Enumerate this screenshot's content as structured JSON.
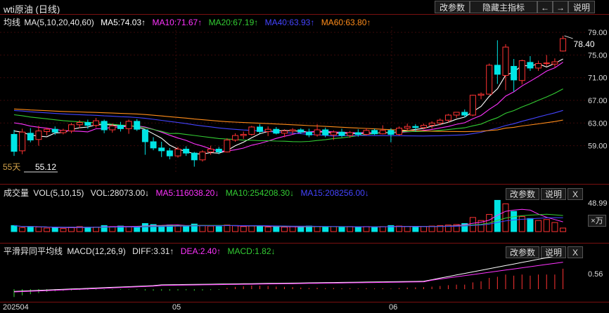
{
  "title": "wti原油 (日线)",
  "toolbar": {
    "modify_params": "改参数",
    "hide_indicator": "隐藏主指标",
    "prev_arrow": "←",
    "next_arrow": "→",
    "explain": "说明"
  },
  "main_panel": {
    "info": {
      "label": "均线",
      "ma_def": "MA(5,10,20,40,60)",
      "ma5": "MA5:74.03↑",
      "ma10": "MA10:71.67↑",
      "ma20": "MA20:67.19↑",
      "ma40": "MA40:63.93↑",
      "ma60": "MA60:63.80↑"
    },
    "colors": {
      "ma5": "#ffffff",
      "ma10": "#ff33ff",
      "ma20": "#33cc33",
      "ma40": "#4444ff",
      "ma60": "#ff8c1a",
      "up": "#ff3333",
      "down": "#00e5e5"
    },
    "y_ticks": [
      "79.00",
      "75.00",
      "71.00",
      "67.00",
      "63.00",
      "59.00"
    ],
    "high_label": "78.40",
    "low_prefix": "55天",
    "low_label": "55.12"
  },
  "volume_panel": {
    "info": {
      "label": "成交量",
      "def": "VOL(5,10,15)",
      "vol": "VOL:28073.00↓",
      "ma5": "MA5:116038.20↓",
      "ma10": "MA10:254208.30↓",
      "ma15": "MA15:208256.00↓"
    },
    "y_tick": "48.99",
    "unit": "×万",
    "modify_params": "改参数",
    "explain": "说明",
    "close": "X"
  },
  "macd_panel": {
    "info": {
      "label": "平滑异同平均线",
      "def": "MACD(12,26,9)",
      "diff": "DIFF:3.31↑",
      "dea": "DEA:2.40↑",
      "macd": "MACD:1.82↓"
    },
    "y_tick": "0.56",
    "modify_params": "改参数",
    "explain": "说明",
    "close": "X"
  },
  "x_axis": {
    "labels": [
      "202504",
      "05",
      "06"
    ]
  },
  "chart_data": {
    "type": "candlestick",
    "title": "wti原油 (日线)",
    "ylim": [
      54,
      80
    ],
    "candles": [
      {
        "o": 61.0,
        "h": 61.8,
        "l": 57.2,
        "c": 58.0
      },
      {
        "o": 58.1,
        "h": 62.0,
        "l": 57.5,
        "c": 61.4
      },
      {
        "o": 61.2,
        "h": 62.1,
        "l": 59.6,
        "c": 60.0
      },
      {
        "o": 60.1,
        "h": 62.5,
        "l": 59.0,
        "c": 61.6
      },
      {
        "o": 61.5,
        "h": 62.2,
        "l": 60.8,
        "c": 61.9
      },
      {
        "o": 61.9,
        "h": 62.4,
        "l": 60.9,
        "c": 61.4
      },
      {
        "o": 61.3,
        "h": 62.0,
        "l": 61.0,
        "c": 61.7
      },
      {
        "o": 61.6,
        "h": 63.0,
        "l": 61.2,
        "c": 62.7
      },
      {
        "o": 62.7,
        "h": 63.5,
        "l": 62.1,
        "c": 63.1
      },
      {
        "o": 63.1,
        "h": 63.6,
        "l": 62.0,
        "c": 62.6
      },
      {
        "o": 62.6,
        "h": 63.9,
        "l": 62.2,
        "c": 63.4
      },
      {
        "o": 63.3,
        "h": 63.6,
        "l": 61.2,
        "c": 61.8
      },
      {
        "o": 61.8,
        "h": 62.9,
        "l": 61.3,
        "c": 62.5
      },
      {
        "o": 62.6,
        "h": 63.2,
        "l": 61.5,
        "c": 62.0
      },
      {
        "o": 62.0,
        "h": 63.6,
        "l": 61.1,
        "c": 63.3
      },
      {
        "o": 63.3,
        "h": 63.7,
        "l": 61.6,
        "c": 61.9
      },
      {
        "o": 61.8,
        "h": 61.9,
        "l": 57.4,
        "c": 59.7
      },
      {
        "o": 59.7,
        "h": 60.5,
        "l": 58.2,
        "c": 58.6
      },
      {
        "o": 58.6,
        "h": 59.7,
        "l": 57.0,
        "c": 58.1
      },
      {
        "o": 58.1,
        "h": 58.6,
        "l": 56.6,
        "c": 57.2
      },
      {
        "o": 57.2,
        "h": 58.8,
        "l": 56.9,
        "c": 58.4
      },
      {
        "o": 58.4,
        "h": 58.9,
        "l": 57.2,
        "c": 57.7
      },
      {
        "o": 57.7,
        "h": 57.9,
        "l": 55.3,
        "c": 56.5
      },
      {
        "o": 56.5,
        "h": 58.2,
        "l": 56.2,
        "c": 57.9
      },
      {
        "o": 57.9,
        "h": 59.0,
        "l": 57.4,
        "c": 58.4
      },
      {
        "o": 58.4,
        "h": 58.8,
        "l": 57.5,
        "c": 57.9
      },
      {
        "o": 57.9,
        "h": 60.3,
        "l": 57.8,
        "c": 60.0
      },
      {
        "o": 60.0,
        "h": 61.2,
        "l": 59.7,
        "c": 60.8
      },
      {
        "o": 60.8,
        "h": 61.5,
        "l": 60.2,
        "c": 61.0
      },
      {
        "o": 61.0,
        "h": 62.5,
        "l": 60.8,
        "c": 62.3
      },
      {
        "o": 62.3,
        "h": 62.8,
        "l": 61.2,
        "c": 61.5
      },
      {
        "o": 61.5,
        "h": 62.4,
        "l": 60.7,
        "c": 61.9
      },
      {
        "o": 61.9,
        "h": 62.3,
        "l": 61.0,
        "c": 61.2
      },
      {
        "o": 61.2,
        "h": 61.9,
        "l": 60.5,
        "c": 61.6
      },
      {
        "o": 61.6,
        "h": 62.1,
        "l": 61.0,
        "c": 61.8
      },
      {
        "o": 61.8,
        "h": 62.1,
        "l": 61.1,
        "c": 61.4
      },
      {
        "o": 61.4,
        "h": 62.0,
        "l": 60.5,
        "c": 60.9
      },
      {
        "o": 60.9,
        "h": 62.8,
        "l": 60.6,
        "c": 61.8
      },
      {
        "o": 61.8,
        "h": 62.2,
        "l": 60.5,
        "c": 60.9
      },
      {
        "o": 60.9,
        "h": 61.7,
        "l": 60.0,
        "c": 61.4
      },
      {
        "o": 61.4,
        "h": 62.0,
        "l": 60.5,
        "c": 60.8
      },
      {
        "o": 60.8,
        "h": 61.6,
        "l": 60.4,
        "c": 61.3
      },
      {
        "o": 61.3,
        "h": 61.9,
        "l": 60.6,
        "c": 61.0
      },
      {
        "o": 61.0,
        "h": 62.1,
        "l": 60.8,
        "c": 61.7
      },
      {
        "o": 61.7,
        "h": 62.0,
        "l": 60.9,
        "c": 61.1
      },
      {
        "o": 61.1,
        "h": 62.6,
        "l": 61.0,
        "c": 61.7
      },
      {
        "o": 61.7,
        "h": 62.1,
        "l": 59.6,
        "c": 61.0
      },
      {
        "o": 61.0,
        "h": 62.4,
        "l": 60.8,
        "c": 62.1
      },
      {
        "o": 62.1,
        "h": 62.9,
        "l": 61.8,
        "c": 62.4
      },
      {
        "o": 62.4,
        "h": 62.8,
        "l": 61.5,
        "c": 62.2
      },
      {
        "o": 62.2,
        "h": 62.9,
        "l": 61.9,
        "c": 62.6
      },
      {
        "o": 62.6,
        "h": 63.3,
        "l": 62.0,
        "c": 63.0
      },
      {
        "o": 63.0,
        "h": 63.8,
        "l": 62.6,
        "c": 63.5
      },
      {
        "o": 63.5,
        "h": 64.6,
        "l": 63.1,
        "c": 64.4
      },
      {
        "o": 64.4,
        "h": 64.9,
        "l": 63.9,
        "c": 64.9
      },
      {
        "o": 64.9,
        "h": 65.4,
        "l": 64.0,
        "c": 64.4
      },
      {
        "o": 64.4,
        "h": 68.0,
        "l": 64.2,
        "c": 67.9
      },
      {
        "o": 67.9,
        "h": 68.4,
        "l": 67.2,
        "c": 68.1
      },
      {
        "o": 68.1,
        "h": 73.5,
        "l": 68.0,
        "c": 73.2
      },
      {
        "o": 73.2,
        "h": 77.6,
        "l": 69.9,
        "c": 71.6
      },
      {
        "o": 71.4,
        "h": 76.9,
        "l": 68.8,
        "c": 76.4
      },
      {
        "o": 73.0,
        "h": 74.3,
        "l": 68.5,
        "c": 70.6
      },
      {
        "o": 70.5,
        "h": 74.2,
        "l": 69.8,
        "c": 74.0
      },
      {
        "o": 73.7,
        "h": 74.8,
        "l": 72.2,
        "c": 72.7
      },
      {
        "o": 72.7,
        "h": 74.0,
        "l": 72.2,
        "c": 73.5
      },
      {
        "o": 73.5,
        "h": 75.0,
        "l": 73.0,
        "c": 73.6
      },
      {
        "o": 73.4,
        "h": 74.4,
        "l": 72.9,
        "c": 73.8
      },
      {
        "o": 75.7,
        "h": 78.4,
        "l": 75.6,
        "c": 77.9
      }
    ],
    "volume": [
      12,
      8,
      10,
      9,
      7,
      8,
      6,
      9,
      10,
      8,
      9,
      12,
      10,
      11,
      9,
      10,
      16,
      14,
      12,
      13,
      11,
      10,
      15,
      12,
      11,
      10,
      13,
      12,
      10,
      11,
      10,
      9,
      10,
      9,
      10,
      9,
      11,
      10,
      9,
      10,
      9,
      10,
      9,
      10,
      9,
      10,
      12,
      11,
      10,
      9,
      10,
      11,
      12,
      13,
      14,
      16,
      28,
      22,
      34,
      62,
      55,
      40,
      30,
      26,
      22,
      24,
      18,
      7
    ],
    "macd_hist": [
      -0.7,
      -0.55,
      -0.45,
      -0.35,
      -0.25,
      -0.2,
      -0.15,
      -0.12,
      -0.08,
      -0.06,
      -0.05,
      -0.05,
      -0.05,
      -0.05,
      -0.05,
      -0.06,
      -0.12,
      -0.14,
      -0.14,
      -0.14,
      -0.12,
      -0.1,
      -0.14,
      -0.12,
      -0.08,
      -0.06,
      0.1,
      0.2,
      0.25,
      0.32,
      0.3,
      0.28,
      0.22,
      0.2,
      0.18,
      0.14,
      0.1,
      0.12,
      0.08,
      0.1,
      0.07,
      0.08,
      0.06,
      0.08,
      0.06,
      0.07,
      0.05,
      0.1,
      0.14,
      0.16,
      0.18,
      0.22,
      0.28,
      0.35,
      0.4,
      0.4,
      0.6,
      0.7,
      1.0,
      1.1,
      1.3,
      1.2,
      1.3,
      1.2,
      1.3,
      1.3,
      1.3,
      1.82
    ]
  }
}
